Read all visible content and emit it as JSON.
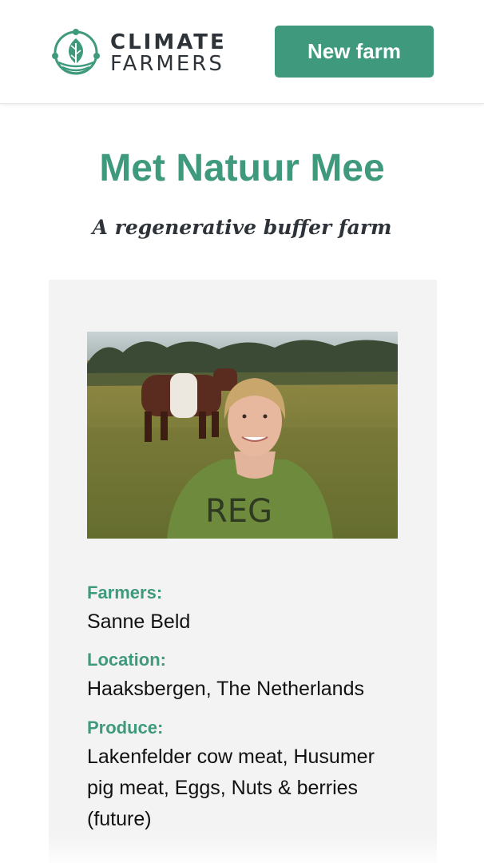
{
  "header": {
    "logo": {
      "line1": "CLIMATE",
      "line2": "FARMERS",
      "icon": "leaf-circle-logo"
    },
    "new_farm_label": "New farm"
  },
  "farm": {
    "name": "Met Natuur Mee",
    "tagline": "A regenerative buffer farm",
    "photo_icon": "farmer-photo",
    "details": {
      "farmers_label": "Farmers:",
      "farmers_value": "Sanne Beld",
      "location_label": "Location:",
      "location_value": "Haaksbergen, The Netherlands",
      "produce_label": "Produce:",
      "produce_value": "Lakenfelder cow meat, Husumer pig meat, Eggs, Nuts & berries (future)"
    }
  },
  "colors": {
    "brand_green": "#3f9a7d",
    "text_dark": "#2d3338",
    "card_bg": "#f3f3f3"
  }
}
